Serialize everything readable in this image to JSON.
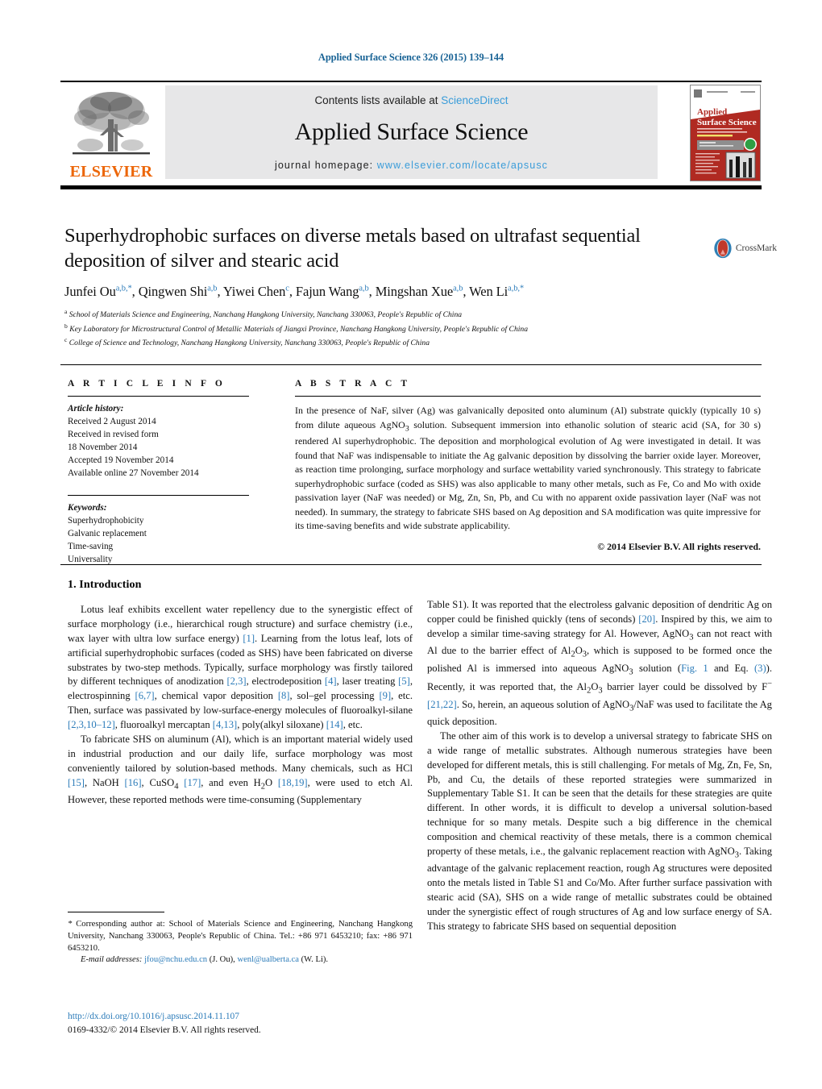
{
  "running_head": "Applied Surface Science 326 (2015) 139–144",
  "masthead": {
    "publisher": "ELSEVIER",
    "contents_prefix": "Contents lists available at ",
    "contents_link": "ScienceDirect",
    "journal_title": "Applied Surface Science",
    "homepage_prefix": "journal homepage: ",
    "homepage_url": "www.elsevier.com/locate/apsusc",
    "cover": {
      "line1": "Applied",
      "line2": "Surface Science"
    }
  },
  "article": {
    "title": "Superhydrophobic surfaces on diverse metals based on ultrafast sequential deposition of silver and stearic acid",
    "crossmark_label": "CrossMark",
    "authors_html": "Junfei Ou<sup>a,b,*</sup>, Qingwen Shi<sup>a,b</sup>, Yiwei Chen<sup>c</sup>, Fajun Wang<sup>a,b</sup>, Mingshan Xue<sup>a,b</sup>, Wen Li<sup>a,b,*</sup>",
    "affiliations": [
      "School of Materials Science and Engineering, Nanchang Hangkong University, Nanchang 330063, People's Republic of China",
      "Key Laboratory for Microstructural Control of Metallic Materials of Jiangxi Province, Nanchang Hangkong University, People's Republic of China",
      "College of Science and Technology, Nanchang Hangkong University, Nanchang 330063, People's Republic of China"
    ],
    "affiliation_marks": [
      "a",
      "b",
      "c"
    ]
  },
  "article_info": {
    "heading": "A R T I C L E    I N F O",
    "history_label": "Article history:",
    "history": [
      "Received 2 August 2014",
      "Received in revised form",
      "18 November 2014",
      "Accepted 19 November 2014",
      "Available online 27 November 2014"
    ],
    "keywords_label": "Keywords:",
    "keywords": [
      "Superhydrophobicity",
      "Galvanic replacement",
      "Time-saving",
      "Universality"
    ]
  },
  "abstract": {
    "heading": "A B S T R A C T",
    "text": "In the presence of NaF, silver (Ag) was galvanically deposited onto aluminum (Al) substrate quickly (typically 10 s) from dilute aqueous AgNO3 solution. Subsequent immersion into ethanolic solution of stearic acid (SA, for 30 s) rendered Al superhydrophobic. The deposition and morphological evolution of Ag were investigated in detail. It was found that NaF was indispensable to initiate the Ag galvanic deposition by dissolving the barrier oxide layer. Moreover, as reaction time prolonging, surface morphology and surface wettability varied synchronously. This strategy to fabricate superhydrophobic surface (coded as SHS) was also applicable to many other metals, such as Fe, Co and Mo with oxide passivation layer (NaF was needed) or Mg, Zn, Sn, Pb, and Cu with no apparent oxide passivation layer (NaF was not needed). In summary, the strategy to fabricate SHS based on Ag deposition and SA modification was quite impressive for its time-saving benefits and wide substrate applicability.",
    "copyright": "© 2014 Elsevier B.V. All rights reserved."
  },
  "body": {
    "section_heading": "1.  Introduction",
    "left_paragraph_1_html": "Lotus leaf exhibits excellent water repellency due to the synergistic effect of surface morphology (i.e., hierarchical rough structure) and surface chemistry (i.e., wax layer with ultra low surface energy) <span class=\"ref\">[1]</span>. Learning from the lotus leaf, lots of artificial superhydrophobic surfaces (coded as SHS) have been fabricated on diverse substrates by two-step methods. Typically, surface morphology was firstly tailored by different techniques of anodization <span class=\"ref\">[2,3]</span>, electrodeposition <span class=\"ref\">[4]</span>, laser treating <span class=\"ref\">[5]</span>, electrospinning <span class=\"ref\">[6,7]</span>, chemical vapor deposition <span class=\"ref\">[8]</span>, sol–gel processing <span class=\"ref\">[9]</span>, etc. Then, surface was passivated by low-surface-energy molecules of fluoroalkyl-silane <span class=\"ref\">[2,3,10–12]</span>, fluoroalkyl mercaptan <span class=\"ref\">[4,13]</span>, poly(alkyl siloxane) <span class=\"ref\">[14]</span>, etc.",
    "left_paragraph_2_html": "To fabricate SHS on aluminum (Al), which is an important material widely used in industrial production and our daily life, surface morphology was most conveniently tailored by solution-based methods. Many chemicals, such as HCl <span class=\"ref\">[15]</span>, NaOH <span class=\"ref\">[16]</span>, CuSO<sub>4</sub> <span class=\"ref\">[17]</span>, and even H<sub>2</sub>O <span class=\"ref\">[18,19]</span>, were used to etch Al. However, these reported methods were time-consuming (Supplementary",
    "right_paragraph_1_html": "Table S1). It was reported that the electroless galvanic deposition of dendritic Ag on copper could be finished quickly (tens of seconds) <span class=\"ref\">[20]</span>. Inspired by this, we aim to develop a similar time-saving strategy for Al. However, AgNO<sub>3</sub> can not react with Al due to the barrier effect of Al<sub>2</sub>O<sub>3</sub>, which is supposed to be formed once the polished Al is immersed into aqueous AgNO<sub>3</sub> solution (<span class=\"ref\">Fig. 1</span> and Eq. <span class=\"ref\">(3)</span>). Recently, it was reported that, the Al<sub>2</sub>O<sub>3</sub> barrier layer could be dissolved by F<sup>−</sup> <span class=\"ref\">[21,22]</span>. So, herein, an aqueous solution of AgNO<sub>3</sub>/NaF was used to facilitate the Ag quick deposition.",
    "right_paragraph_2_html": "The other aim of this work is to develop a universal strategy to fabricate SHS on a wide range of metallic substrates. Although numerous strategies have been developed for different metals, this is still challenging. For metals of Mg, Zn, Fe, Sn, Pb, and Cu, the details of these reported strategies were summarized in Supplementary Table S1. It can be seen that the details for these strategies are quite different. In other words, it is difficult to develop a universal solution-based technique for so many metals. Despite such a big difference in the chemical composition and chemical reactivity of these metals, there is a common chemical property of these metals, i.e., the galvanic replacement reaction with AgNO<sub>3</sub>. Taking advantage of the galvanic replacement reaction, rough Ag structures were deposited onto the metals listed in Table S1 and Co/Mo. After further surface passivation with stearic acid (SA), SHS on a wide range of metallic substrates could be obtained under the synergistic effect of rough structures of Ag and low surface energy of SA. This strategy to fabricate SHS based on sequential deposition"
  },
  "footnotes": {
    "corresponding_html": "<span class=\"em\">*</span> Corresponding author at: School of Materials Science and Engineering, Nanchang Hangkong University, Nanchang 330063, People's Republic of China. Tel.: +86 971 6453210; fax: +86 971 6453210.",
    "email_html": "<span class=\"em\">E-mail addresses:</span> <span class=\"link\">jfou@nchu.edu.cn</span> (J. Ou), <span class=\"link\">wenl@ualberta.ca</span> (W. Li).",
    "doi": "http://dx.doi.org/10.1016/j.apsusc.2014.11.107",
    "issn": "0169-4332/© 2014 Elsevier B.V. All rights reserved."
  },
  "colors": {
    "link": "#2b7bb9",
    "sciencedirect": "#3a9cd9",
    "elsevier_orange": "#ec6608",
    "running_head": "#1a6496",
    "masthead_bg": "#e7e7e8"
  }
}
